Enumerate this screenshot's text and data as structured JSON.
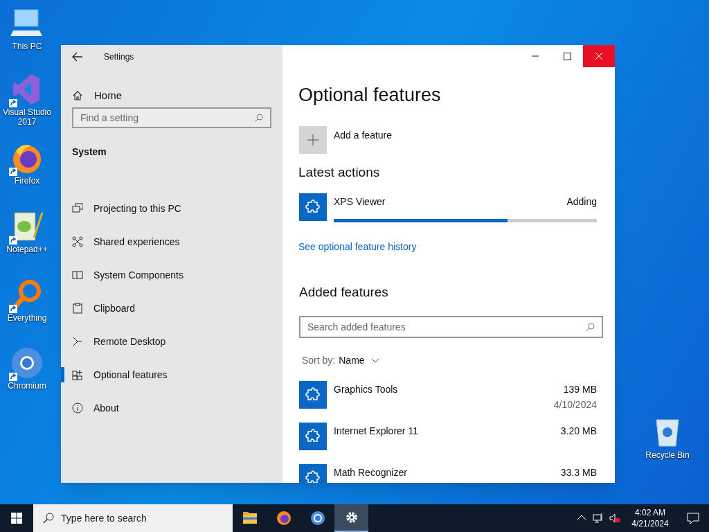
{
  "desktop": {
    "icons": [
      {
        "label": "This PC",
        "shortcut": false
      },
      {
        "label": "Visual Studio 2017",
        "shortcut": true
      },
      {
        "label": "Firefox",
        "shortcut": true
      },
      {
        "label": "Notepad++",
        "shortcut": true
      },
      {
        "label": "Everything",
        "shortcut": true
      },
      {
        "label": "Chromium",
        "shortcut": true
      },
      {
        "label": "Recycle Bin",
        "shortcut": false
      }
    ]
  },
  "window": {
    "title": "Settings",
    "sidebar": {
      "home": "Home",
      "search": {
        "placeholder": "Find a setting"
      },
      "section": "System",
      "items": [
        {
          "label": "Projecting to this PC",
          "selected": false
        },
        {
          "label": "Shared experiences",
          "selected": false
        },
        {
          "label": "System Components",
          "selected": false
        },
        {
          "label": "Clipboard",
          "selected": false
        },
        {
          "label": "Remote Desktop",
          "selected": false
        },
        {
          "label": "Optional features",
          "selected": true
        },
        {
          "label": "About",
          "selected": false
        }
      ]
    },
    "main": {
      "title": "Optional features",
      "add_feature": "Add a feature",
      "latest_heading": "Latest actions",
      "actions": [
        {
          "name": "XPS Viewer",
          "status": "Adding",
          "level": 0.66
        }
      ],
      "history_link": "See optional feature history",
      "added_heading": "Added features",
      "search": {
        "placeholder": "Search added features"
      },
      "sort_label": "Sort by:",
      "sort_value": "Name",
      "features": [
        {
          "name": "Graphics Tools",
          "size": "139 MB",
          "date": "4/10/2024"
        },
        {
          "name": "Internet Explorer 11",
          "size": "3.20 MB"
        },
        {
          "name": "Math Recognizer",
          "size": "33.3 MB"
        }
      ]
    }
  },
  "taskbar": {
    "search": {
      "placeholder": "Type here to search"
    },
    "apps": [
      {
        "selected": false
      },
      {
        "selected": false
      },
      {
        "selected": false
      },
      {
        "selected": true
      }
    ],
    "time": "4:02 AM",
    "date": "4/21/2024"
  }
}
